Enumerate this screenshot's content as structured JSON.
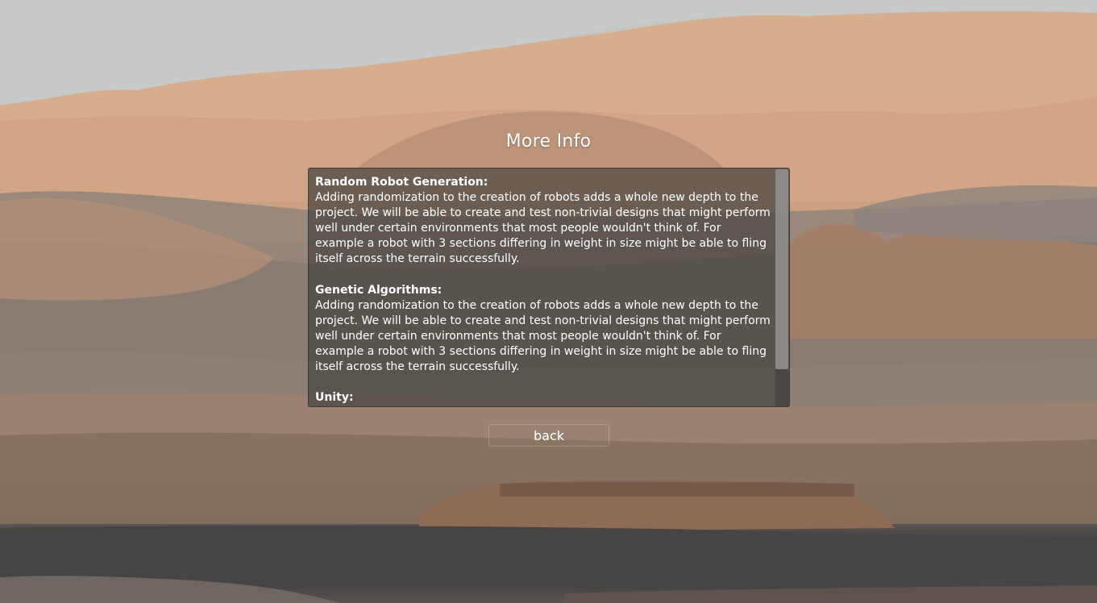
{
  "screen": {
    "title": "More Info",
    "background": "mars-landscape-image"
  },
  "info_panel": {
    "sections": [
      {
        "heading": "Random Robot Generation:",
        "body": "Adding randomization to the creation of robots adds a whole new depth to the project. We will be able to create and test non-trivial designs that might perform well under certain environments that most people wouldn't think of. For example a robot with 3 sections differing in weight in size might be able to fling itself across the terrain successfully."
      },
      {
        "heading": "Genetic Algorithms:",
        "body": "Adding randomization to the creation of robots adds a whole new depth to the project. We will be able to create and test non-trivial designs that might perform well under certain environments that most people wouldn't think of. For example a robot with 3 sections differing in weight in size might be able to fling itself across the terrain successfully."
      },
      {
        "heading": "Unity:",
        "body": ""
      }
    ]
  },
  "buttons": {
    "back_label": "back"
  }
}
